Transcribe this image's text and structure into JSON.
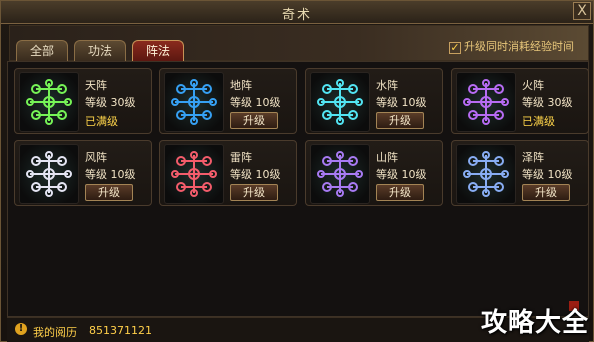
{
  "window": {
    "title": "奇术",
    "close_label": "X"
  },
  "tabs": [
    {
      "label": "全部",
      "active": false
    },
    {
      "label": "功法",
      "active": false
    },
    {
      "label": "阵法",
      "active": true
    }
  ],
  "upgrade_option": {
    "label": "升级同时消耗经验时间",
    "checked": true
  },
  "formations": [
    {
      "name": "天阵",
      "level": "等级  30级",
      "status": "已满级",
      "maxed": true,
      "glow": "#7cff5a"
    },
    {
      "name": "地阵",
      "level": "等级  10级",
      "status": "升级",
      "maxed": false,
      "glow": "#38a8ff"
    },
    {
      "name": "水阵",
      "level": "等级  10级",
      "status": "升级",
      "maxed": false,
      "glow": "#56f0ff"
    },
    {
      "name": "火阵",
      "level": "等级  30级",
      "status": "已满级",
      "maxed": true,
      "glow": "#c070ff"
    },
    {
      "name": "风阵",
      "level": "等级  10级",
      "status": "升级",
      "maxed": false,
      "glow": "#f0f0ff"
    },
    {
      "name": "雷阵",
      "level": "等级  10级",
      "status": "升级",
      "maxed": false,
      "glow": "#ff6070"
    },
    {
      "name": "山阵",
      "level": "等级  10级",
      "status": "升级",
      "maxed": false,
      "glow": "#b080ff"
    },
    {
      "name": "泽阵",
      "level": "等级  10级",
      "status": "升级",
      "maxed": false,
      "glow": "#8fb5ff"
    }
  ],
  "footer": {
    "label": "我的阅历",
    "value": "851371121"
  },
  "watermark": "攻略大全"
}
